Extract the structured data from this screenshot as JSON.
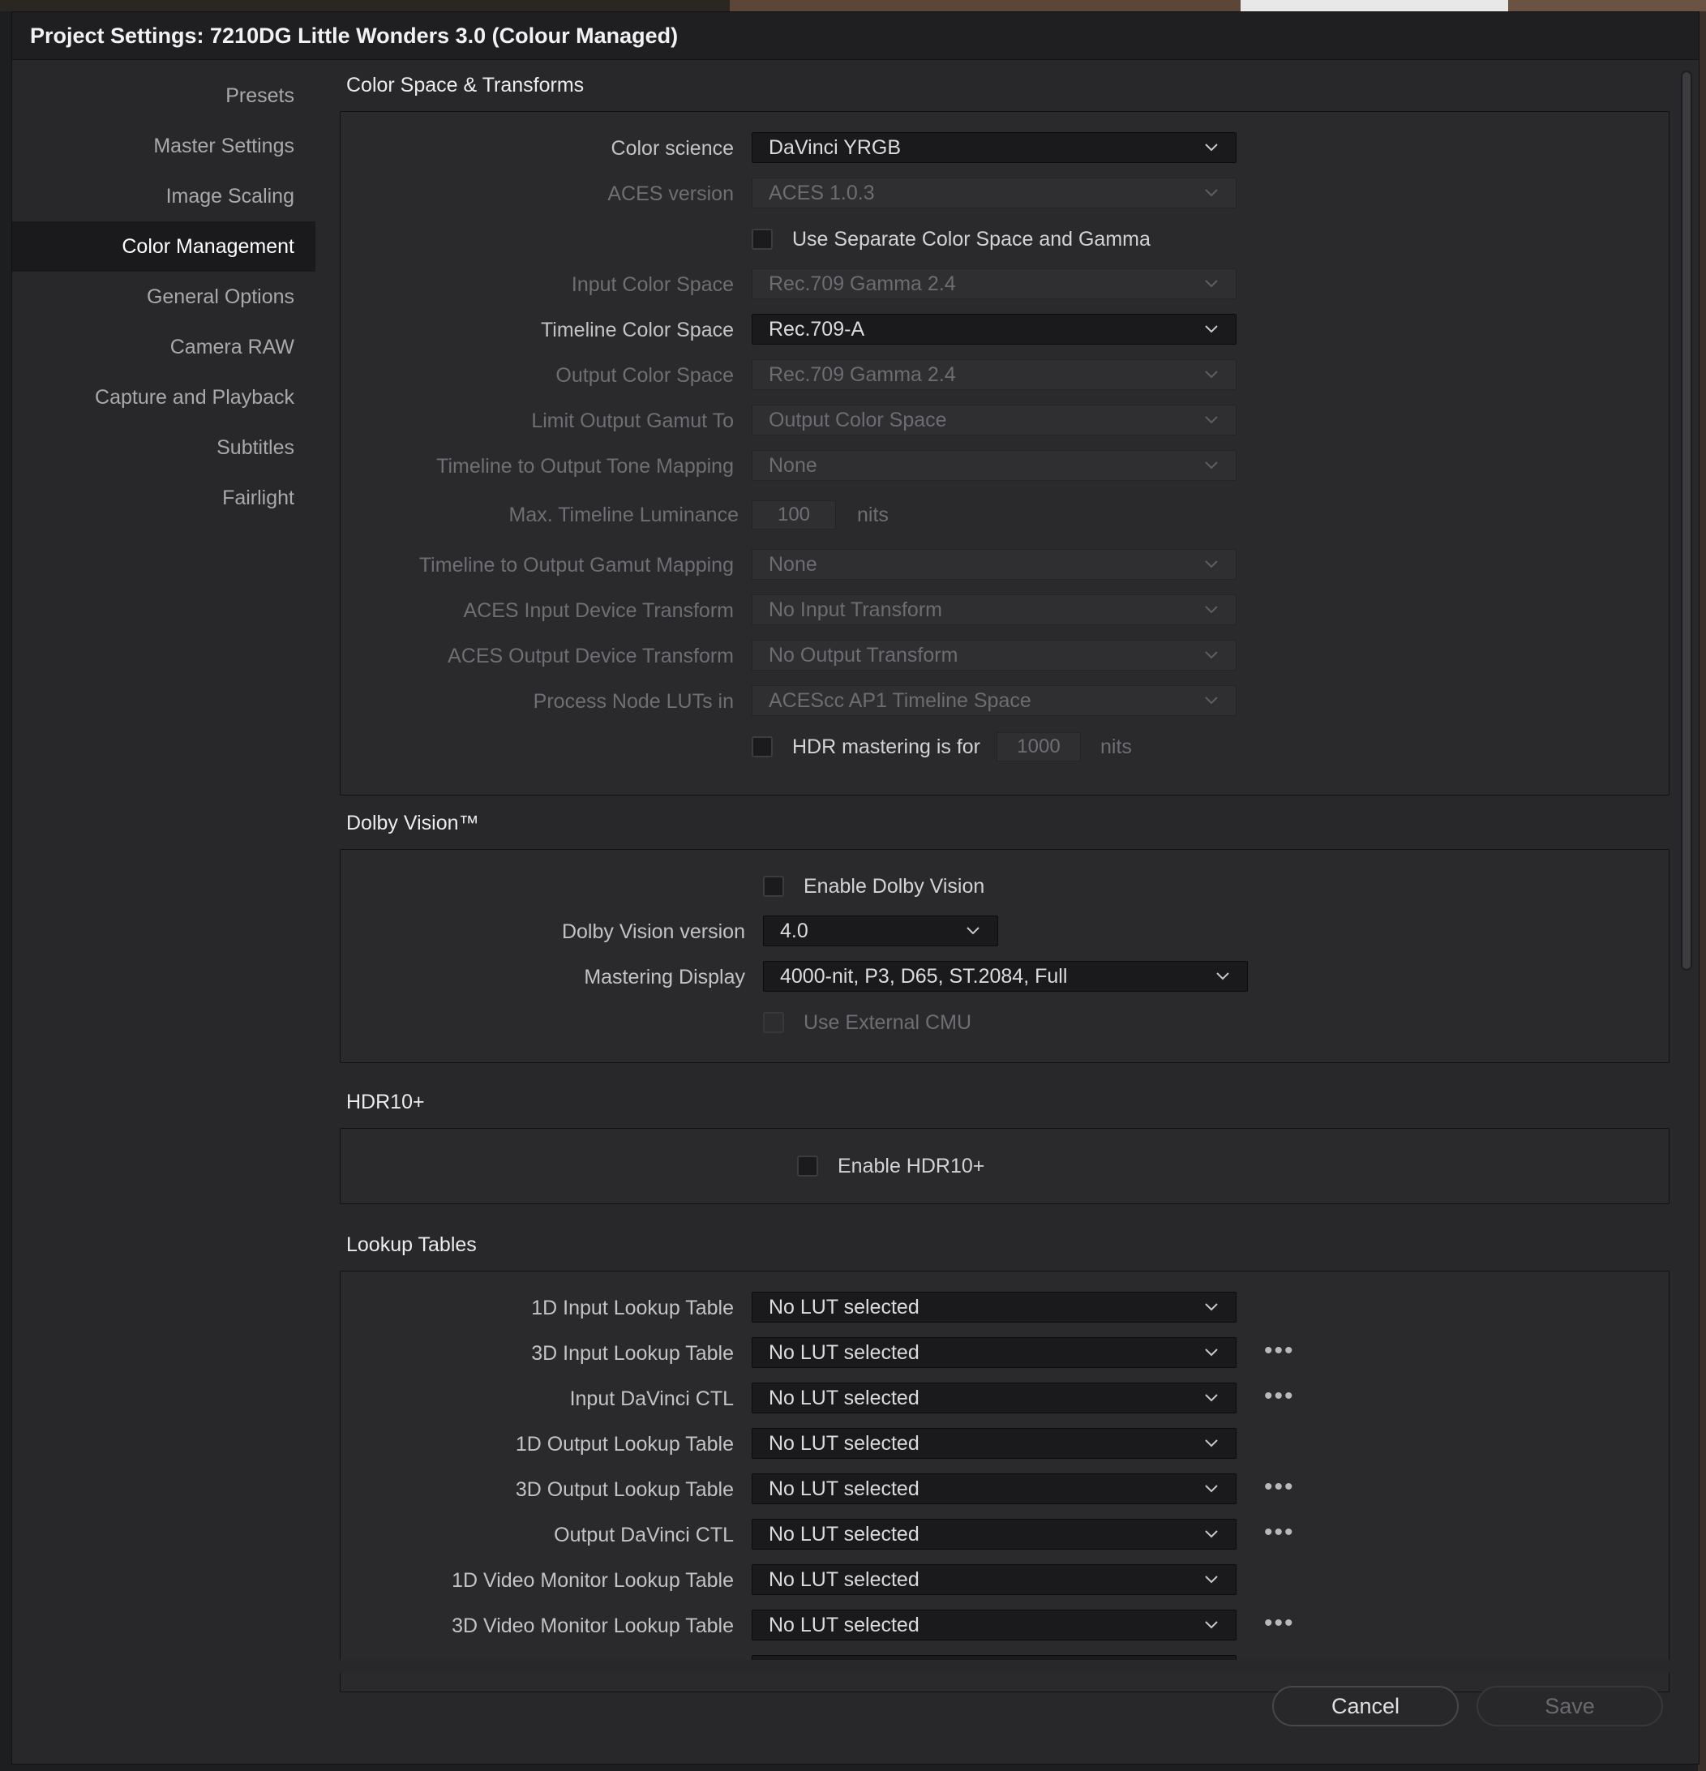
{
  "window": {
    "title": "Project Settings:  7210DG Little Wonders 3.0 (Colour Managed)"
  },
  "sidebar": {
    "items": [
      {
        "label": "Presets",
        "active": false
      },
      {
        "label": "Master Settings",
        "active": false
      },
      {
        "label": "Image Scaling",
        "active": false
      },
      {
        "label": "Color Management",
        "active": true
      },
      {
        "label": "General Options",
        "active": false
      },
      {
        "label": "Camera RAW",
        "active": false
      },
      {
        "label": "Capture and Playback",
        "active": false
      },
      {
        "label": "Subtitles",
        "active": false
      },
      {
        "label": "Fairlight",
        "active": false
      }
    ]
  },
  "color_space": {
    "title": "Color Space & Transforms",
    "color_science": {
      "label": "Color science",
      "value": "DaVinci YRGB"
    },
    "aces_version": {
      "label": "ACES version",
      "value": "ACES 1.0.3"
    },
    "separate_cs_gamma": {
      "label": "Use Separate Color Space and Gamma",
      "checked": false
    },
    "input_color_space": {
      "label": "Input Color Space",
      "value": "Rec.709 Gamma 2.4"
    },
    "timeline_color_space": {
      "label": "Timeline Color Space",
      "value": "Rec.709-A"
    },
    "output_color_space": {
      "label": "Output Color Space",
      "value": "Rec.709 Gamma 2.4"
    },
    "limit_output_gamut": {
      "label": "Limit Output Gamut To",
      "value": "Output Color Space"
    },
    "tone_mapping": {
      "label": "Timeline to Output Tone Mapping",
      "value": "None"
    },
    "max_luminance": {
      "label": "Max. Timeline Luminance",
      "value": "100",
      "unit": "nits"
    },
    "gamut_mapping": {
      "label": "Timeline to Output Gamut Mapping",
      "value": "None"
    },
    "aces_idt": {
      "label": "ACES Input Device Transform",
      "value": "No Input Transform"
    },
    "aces_odt": {
      "label": "ACES Output Device Transform",
      "value": "No Output Transform"
    },
    "process_node_luts": {
      "label": "Process Node LUTs in",
      "value": "ACEScc AP1 Timeline Space"
    },
    "hdr_mastering": {
      "label": "HDR mastering is for",
      "value": "1000",
      "unit": "nits",
      "checked": false
    }
  },
  "dolby": {
    "title": "Dolby Vision™",
    "enable": {
      "label": "Enable Dolby Vision",
      "checked": false
    },
    "version": {
      "label": "Dolby Vision version",
      "value": "4.0"
    },
    "mastering_display": {
      "label": "Mastering Display",
      "value": "4000-nit, P3, D65, ST.2084, Full"
    },
    "external_cmu": {
      "label": "Use External CMU",
      "checked": false
    }
  },
  "hdr10": {
    "title": "HDR10+",
    "enable": {
      "label": "Enable HDR10+",
      "checked": false
    }
  },
  "luts": {
    "title": "Lookup Tables",
    "more_glyph": "•••",
    "rows": [
      {
        "label": "1D Input Lookup Table",
        "value": "No LUT selected",
        "more": false
      },
      {
        "label": "3D Input Lookup Table",
        "value": "No LUT selected",
        "more": true
      },
      {
        "label": "Input DaVinci CTL",
        "value": "No LUT selected",
        "more": true
      },
      {
        "label": "1D Output Lookup Table",
        "value": "No LUT selected",
        "more": false
      },
      {
        "label": "3D Output Lookup Table",
        "value": "No LUT selected",
        "more": true
      },
      {
        "label": "Output DaVinci CTL",
        "value": "No LUT selected",
        "more": true
      },
      {
        "label": "1D Video Monitor Lookup Table",
        "value": "No LUT selected",
        "more": false
      },
      {
        "label": "3D Video Monitor Lookup Table",
        "value": "No LUT selected",
        "more": true
      }
    ]
  },
  "footer": {
    "cancel_label": "Cancel",
    "save_label": "Save"
  },
  "colors": {
    "background": "#28282b",
    "dropdown": "#1a1a1c",
    "active_nav": "#1a1a1c",
    "text": "#c9c9cb"
  }
}
